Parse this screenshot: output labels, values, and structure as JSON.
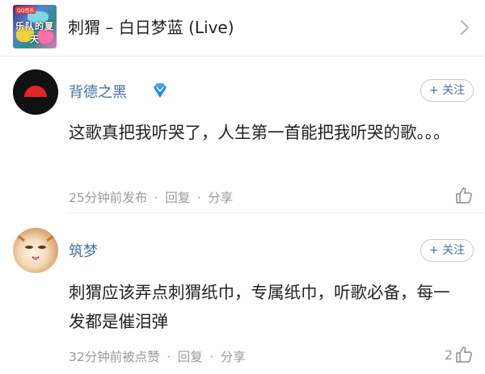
{
  "song": {
    "title": "刺猬 – 白日梦蓝 (Live)",
    "cover_text": "乐队的夏天",
    "cover_tag": "QQ音乐"
  },
  "comments": [
    {
      "username": "背德之黑",
      "vip_badge_icon": "diamond-vip-icon",
      "follow_label": "+ 关注",
      "text": "这歌真把我听哭了，人生第一首能把我听哭的歌。。。",
      "time": "25分钟前发布",
      "reply_label": "回复",
      "share_label": "分享",
      "like_count": "",
      "avatar_icon": "dark-circle-logo"
    },
    {
      "username": "筑梦",
      "follow_label": "+ 关注",
      "text": "刺猬应该弄点刺猬纸巾，专属纸巾，听歌必备，每一发都是催泪弹",
      "time": "32分钟前被点赞",
      "reply_label": "回复",
      "share_label": "分享",
      "like_count": "2",
      "avatar_icon": "cat-photo"
    }
  ],
  "separator": "·",
  "colors": {
    "username": "#4a6fa0",
    "meta": "#9a9a9a",
    "vip": "#3fa9f5"
  }
}
